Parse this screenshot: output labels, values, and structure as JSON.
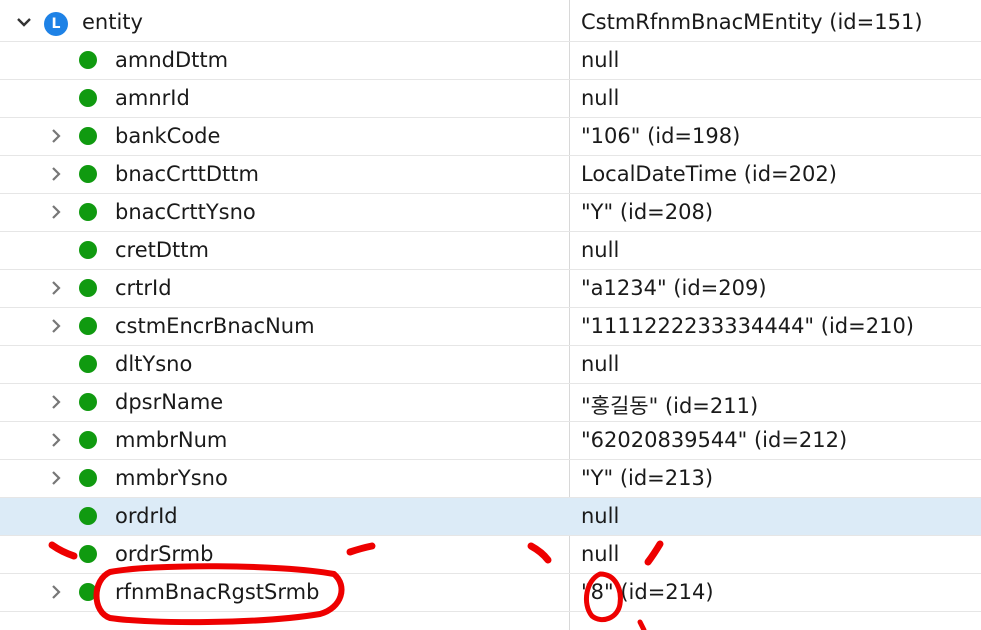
{
  "root": {
    "name": "entity",
    "icon": "local-variable-icon",
    "icon_letter": "L",
    "value": "CstmRfnmBnacMEntity  (id=151)",
    "expanded": true
  },
  "fields": [
    {
      "name": "amndDttm",
      "value": "null",
      "expandable": false
    },
    {
      "name": "amnrId",
      "value": "null",
      "expandable": false
    },
    {
      "name": "bankCode",
      "value": "\"106\" (id=198)",
      "expandable": true
    },
    {
      "name": "bnacCrttDttm",
      "value": "LocalDateTime  (id=202)",
      "expandable": true
    },
    {
      "name": "bnacCrttYsno",
      "value": "\"Y\" (id=208)",
      "expandable": true
    },
    {
      "name": "cretDttm",
      "value": "null",
      "expandable": false
    },
    {
      "name": "crtrId",
      "value": "\"a1234\" (id=209)",
      "expandable": true
    },
    {
      "name": "cstmEncrBnacNum",
      "value": "\"1111222233334444\" (id=210)",
      "expandable": true
    },
    {
      "name": "dltYsno",
      "value": "null",
      "expandable": false
    },
    {
      "name": "dpsrName",
      "value": "\"홍길동\" (id=211)",
      "expandable": true
    },
    {
      "name": "mmbrNum",
      "value": "\"62020839544\" (id=212)",
      "expandable": true
    },
    {
      "name": "mmbrYsno",
      "value": "\"Y\" (id=213)",
      "expandable": true
    },
    {
      "name": "ordrId",
      "value": "null",
      "expandable": false,
      "selected": true
    },
    {
      "name": "ordrSrmb",
      "value": "null",
      "expandable": false
    },
    {
      "name": "rfnmBnacRgstSrmb",
      "value": "\"8\" (id=214)",
      "expandable": true
    }
  ],
  "colors": {
    "field_dot": "#109a10",
    "local_icon": "#1e82e6",
    "selected_row": "#dcebf7",
    "annotation": "#ee0000"
  }
}
